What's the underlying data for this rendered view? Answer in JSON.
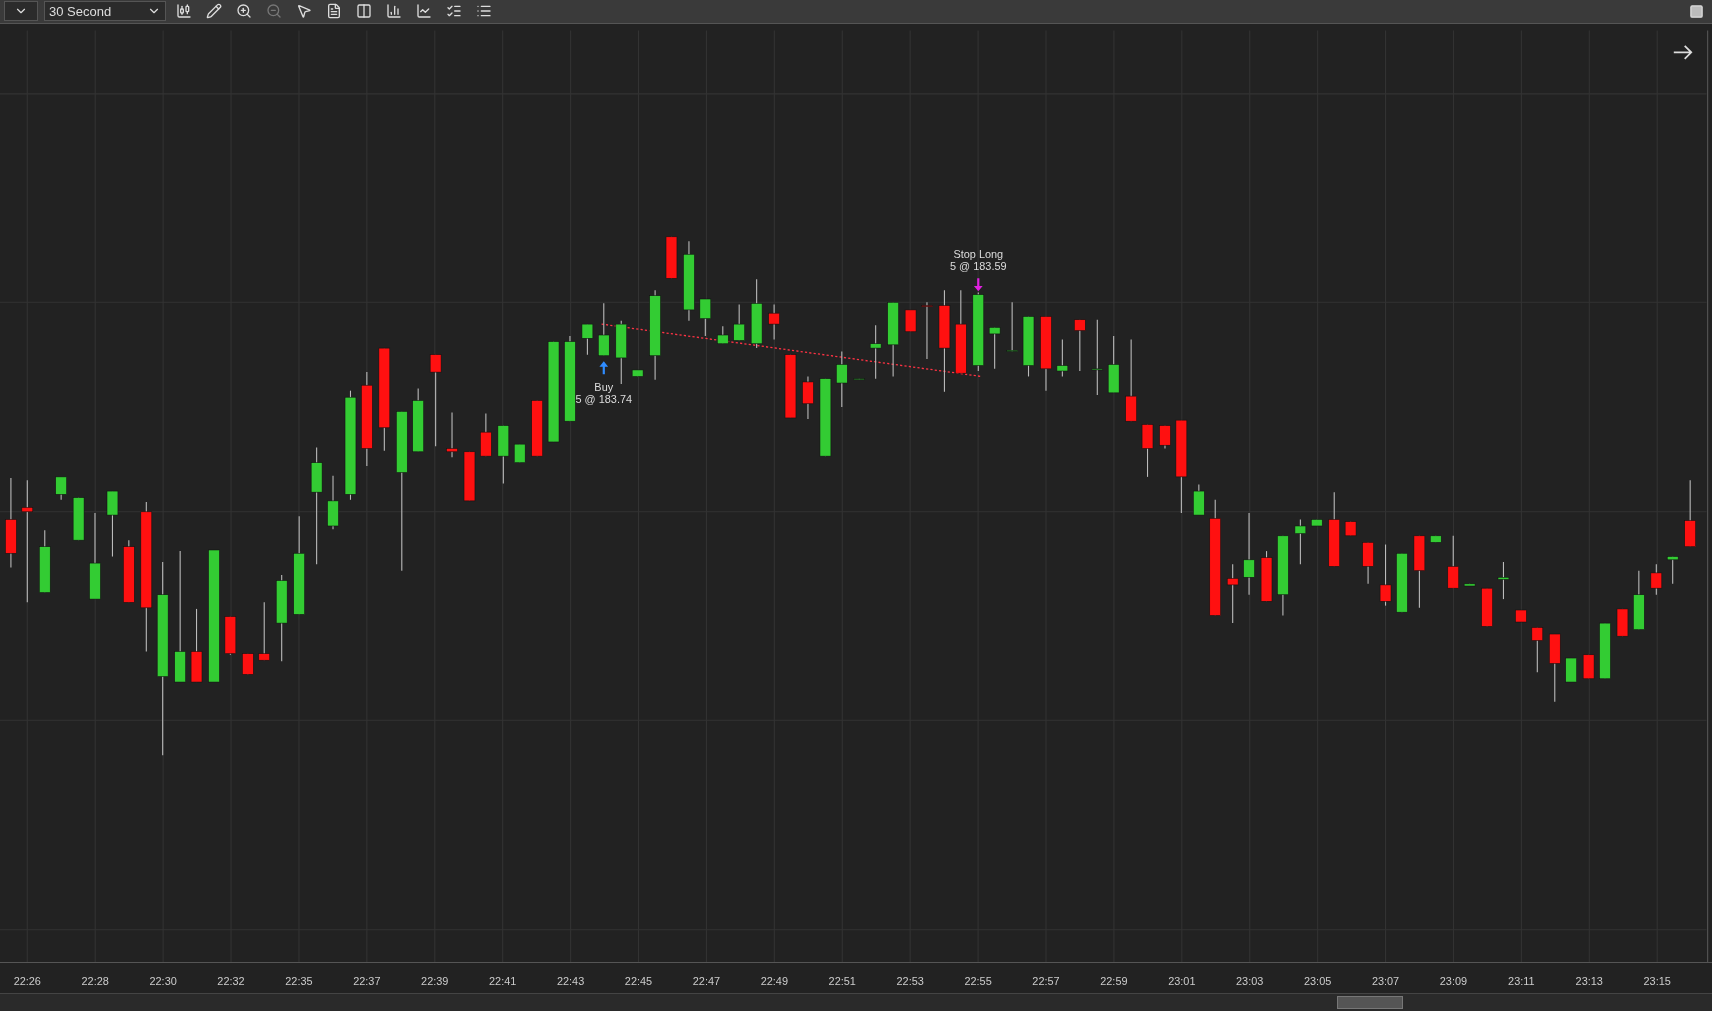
{
  "toolbar": {
    "interval": "30 Second"
  },
  "chart": {
    "time_labels": [
      "22:26",
      "22:28",
      "22:30",
      "22:32",
      "22:35",
      "22:37",
      "22:39",
      "22:41",
      "22:43",
      "22:45",
      "22:47",
      "22:49",
      "22:51",
      "22:53",
      "22:55",
      "22:57",
      "22:59",
      "23:01",
      "23:03",
      "23:05",
      "23:07",
      "23:09",
      "23:11",
      "23:13",
      "23:15"
    ],
    "trades": [
      {
        "kind": "entry",
        "label": "Buy",
        "detail": "5 @ 183.74"
      },
      {
        "kind": "exit",
        "label": "Stop Long",
        "detail": "5 @ 183.59"
      }
    ]
  }
}
